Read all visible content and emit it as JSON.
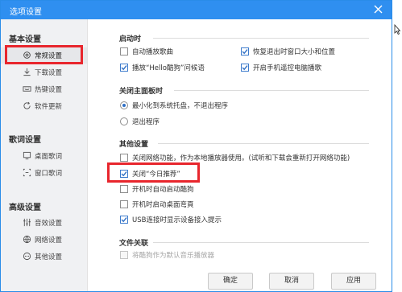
{
  "window": {
    "title": "选项设置",
    "close_icon": "close-icon"
  },
  "sidebar": {
    "sections": [
      {
        "title": "基本设置",
        "items": [
          {
            "label": "常规设置",
            "icon": "gear-icon",
            "active": true
          },
          {
            "label": "下载设置",
            "icon": "download-icon"
          },
          {
            "label": "热键设置",
            "icon": "keyboard-icon"
          },
          {
            "label": "软件更新",
            "icon": "update-icon"
          }
        ]
      },
      {
        "title": "歌词设置",
        "items": [
          {
            "label": "桌面歌词",
            "icon": "desktop-lyrics-icon"
          },
          {
            "label": "窗口歌词",
            "icon": "window-lyrics-icon"
          }
        ]
      },
      {
        "title": "高级设置",
        "items": [
          {
            "label": "音效设置",
            "icon": "equalizer-icon"
          },
          {
            "label": "网络设置",
            "icon": "globe-icon"
          },
          {
            "label": "其他设置",
            "icon": "more-icon"
          }
        ]
      }
    ]
  },
  "main": {
    "startup": {
      "title": "启动时",
      "options": [
        {
          "label": "自动播放歌曲",
          "checked": false
        },
        {
          "label": "恢复退出时窗口大小和位置",
          "checked": true
        },
        {
          "label": "播放“Hello酷狗”问候语",
          "checked": true
        },
        {
          "label": "开启手机遥控电脑播歌",
          "checked": true
        }
      ]
    },
    "close_panel": {
      "title": "关闭主面板时",
      "options": [
        {
          "label": "最小化到系统托盘，不退出程序",
          "selected": true
        },
        {
          "label": "退出程序",
          "selected": false
        }
      ]
    },
    "other": {
      "title": "其他设置",
      "options": [
        {
          "label": "关闭网络功能，作为本地播放器使用。(试听和下载会重新打开网络功能)",
          "checked": false
        },
        {
          "label": "关闭“今日推荐”",
          "checked": true
        },
        {
          "label": "开机时自动启动酷狗",
          "checked": false
        },
        {
          "label": "开机时启动桌面弯頁",
          "checked": false
        },
        {
          "label": "USB连接时显示设备接入提示",
          "checked": true
        }
      ]
    },
    "file_assoc": {
      "title": "文件关联",
      "options": [
        {
          "label": "将酷狗作为默认音乐播放器",
          "checked": false,
          "disabled": true
        }
      ]
    }
  },
  "buttons": {
    "ok": "确定",
    "cancel": "取消",
    "apply": "应用"
  },
  "colors": {
    "titlebar": "#2f8ff0",
    "highlight": "#e8262d",
    "sidebar_bg": "#f0f1f3"
  }
}
